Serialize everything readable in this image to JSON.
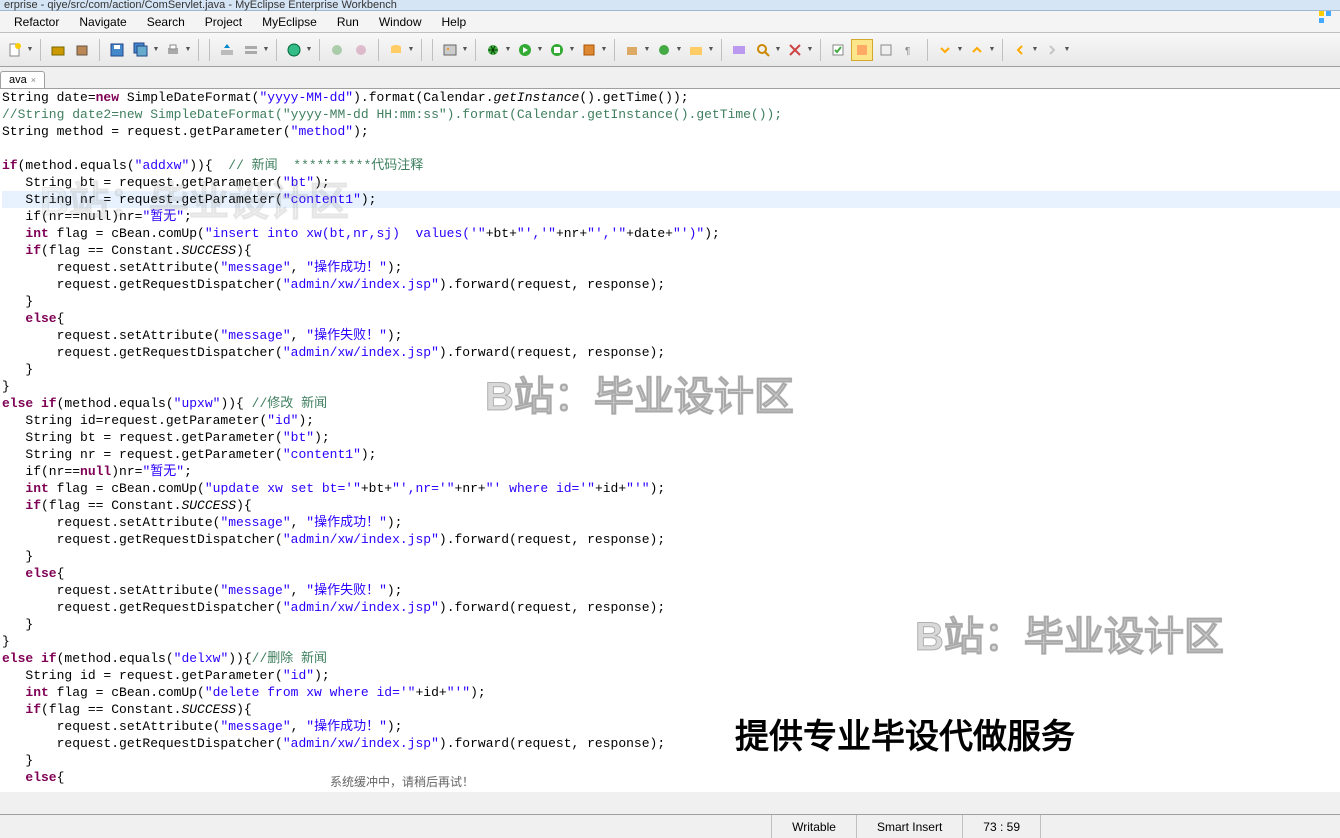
{
  "title": "erprise - qiye/src/com/action/ComServlet.java - MyEclipse Enterprise Workbench",
  "menu": [
    "Refactor",
    "Navigate",
    "Search",
    "Project",
    "MyEclipse",
    "Run",
    "Window",
    "Help"
  ],
  "tab": {
    "label": "ava",
    "close": "×"
  },
  "status": {
    "writable": "Writable",
    "insert": "Smart Insert",
    "pos": "73 : 59"
  },
  "watermark": "B站：毕业设计区",
  "promo": "提供专业毕设代做服务",
  "scroll_msg": "系统缓冲中，请稍后再试！",
  "code": {
    "l1a": "String date=",
    "l1b": "new",
    "l1c": " SimpleDateFormat(",
    "l1d": "\"yyyy-MM-dd\"",
    "l1e": ").format(Calendar.",
    "l1f": "getInstance",
    "l1g": "().getTime());",
    "l2": "//String date2=new SimpleDateFormat(\"yyyy-MM-dd HH:mm:ss\").format(Calendar.getInstance().getTime());",
    "l3a": "String method = request.getParameter(",
    "l3b": "\"method\"",
    "l3c": ");",
    "l5a": "if",
    "l5b": "(method.equals(",
    "l5c": "\"addxw\"",
    "l5d": ")){  ",
    "l5e": "// 新闻  **********代码注释",
    "l6a": "   String bt = request.getParameter(",
    "l6b": "\"bt\"",
    "l6c": ");",
    "l7a": "   String nr = request.getParameter(",
    "l7b": "\"content1\"",
    "l7c": ");",
    "l8a": "   if(nr==null)nr=",
    "l8b": "\"暂无\"",
    "l8c": ";",
    "l9a": "   int",
    "l9b": " flag = cBean.comUp(",
    "l9c": "\"insert into xw(bt,nr,sj)  values('\"",
    "l9d": "+bt+",
    "l9e": "\"','\"",
    "l9f": "+nr+",
    "l9g": "\"','\"",
    "l9h": "+date+",
    "l9i": "\"')\"",
    "l9j": ");",
    "l10a": "   if",
    "l10b": "(flag == Constant.",
    "l10c": "SUCCESS",
    "l10d": "){",
    "l11a": "       request.setAttribute(",
    "l11b": "\"message\"",
    "l11c": ", ",
    "l11d": "\"操作成功！\"",
    "l11e": ");",
    "l12a": "       request.getRequestDispatcher(",
    "l12b": "\"admin/xw/index.jsp\"",
    "l12c": ").forward(request, response);",
    "l13": "   }",
    "l14a": "   else",
    "l14b": "{",
    "l15a": "       request.setAttribute(",
    "l15b": "\"message\"",
    "l15c": ", ",
    "l15d": "\"操作失败！\"",
    "l15e": ");",
    "l16a": "       request.getRequestDispatcher(",
    "l16b": "\"admin/xw/index.jsp\"",
    "l16c": ").forward(request, response);",
    "l17": "   }",
    "l18": "}",
    "l19a": "else if",
    "l19b": "(method.equals(",
    "l19c": "\"upxw\"",
    "l19d": ")){ ",
    "l19e": "//修改 新闻",
    "l20a": "   String id=request.getParameter(",
    "l20b": "\"id\"",
    "l20c": ");",
    "l21a": "   String bt = request.getParameter(",
    "l21b": "\"bt\"",
    "l21c": ");",
    "l22a": "   String nr = request.getParameter(",
    "l22b": "\"content1\"",
    "l22c": ");",
    "l23a": "   if(nr==",
    "l23b": "null",
    "l23c": ")nr=",
    "l23d": "\"暂无\"",
    "l23e": ";",
    "l24a": "   int",
    "l24b": " flag = cBean.comUp(",
    "l24c": "\"update xw set bt='\"",
    "l24d": "+bt+",
    "l24e": "\"',nr='\"",
    "l24f": "+nr+",
    "l24g": "\"' where id='\"",
    "l24h": "+id+",
    "l24i": "\"'\"",
    "l24j": ");",
    "l25a": "   if",
    "l25b": "(flag == Constant.",
    "l25c": "SUCCESS",
    "l25d": "){",
    "l26a": "       request.setAttribute(",
    "l26b": "\"message\"",
    "l26c": ", ",
    "l26d": "\"操作成功！\"",
    "l26e": ");",
    "l27a": "       request.getRequestDispatcher(",
    "l27b": "\"admin/xw/index.jsp\"",
    "l27c": ").forward(request, response);",
    "l28": "   }",
    "l29a": "   else",
    "l29b": "{",
    "l30a": "       request.setAttribute(",
    "l30b": "\"message\"",
    "l30c": ", ",
    "l30d": "\"操作失败！\"",
    "l30e": ");",
    "l31a": "       request.getRequestDispatcher(",
    "l31b": "\"admin/xw/index.jsp\"",
    "l31c": ").forward(request, response);",
    "l32": "   }",
    "l33": "}",
    "l34a": "else if",
    "l34b": "(method.equals(",
    "l34c": "\"delxw\"",
    "l34d": ")){",
    "l34e": "//删除 新闻",
    "l35a": "   String id = request.getParameter(",
    "l35b": "\"id\"",
    "l35c": ");",
    "l36a": "   int",
    "l36b": " flag = cBean.comUp(",
    "l36c": "\"delete from xw where id='\"",
    "l36d": "+id+",
    "l36e": "\"'\"",
    "l36f": ");",
    "l37a": "   if",
    "l37b": "(flag == Constant.",
    "l37c": "SUCCESS",
    "l37d": "){",
    "l38a": "       request.setAttribute(",
    "l38b": "\"message\"",
    "l38c": ", ",
    "l38d": "\"操作成功！\"",
    "l38e": ");",
    "l39a": "       request.getRequestDispatcher(",
    "l39b": "\"admin/xw/index.jsp\"",
    "l39c": ").forward(request, response);",
    "l40": "   }",
    "l41a": "   else",
    "l41b": "{"
  }
}
